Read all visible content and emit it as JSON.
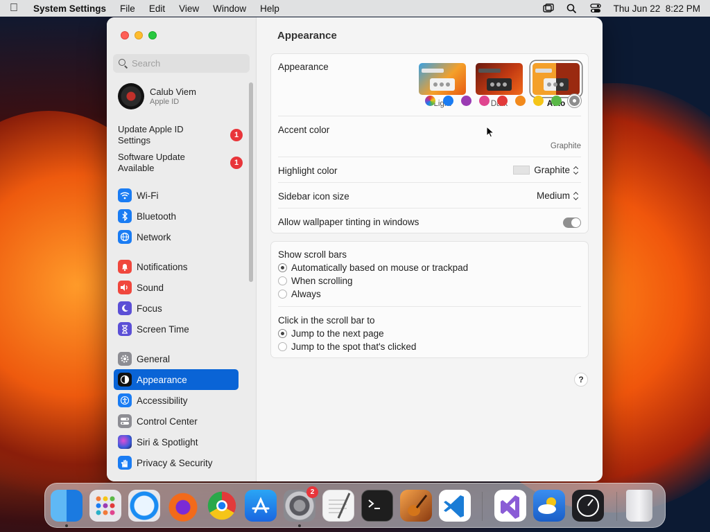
{
  "menubar": {
    "app_name": "System Settings",
    "menus": [
      "File",
      "Edit",
      "View",
      "Window",
      "Help"
    ],
    "clock": "Thu Jun 22  8:22 PM"
  },
  "sidebar": {
    "search_placeholder": "Search",
    "account": {
      "name": "Calub Viem",
      "subtitle": "Apple ID"
    },
    "notifications": [
      {
        "label": "Update Apple ID Settings",
        "badge": "1"
      },
      {
        "label": "Software Update Available",
        "badge": "1"
      }
    ],
    "items": [
      {
        "label": "Wi-Fi",
        "icon": "wifi-icon",
        "color": "#1a7cf3"
      },
      {
        "label": "Bluetooth",
        "icon": "bluetooth-icon",
        "color": "#1a7cf3"
      },
      {
        "label": "Network",
        "icon": "globe-icon",
        "color": "#1a7cf3"
      },
      {
        "label": "Notifications",
        "icon": "bell-icon",
        "color": "#f0473d"
      },
      {
        "label": "Sound",
        "icon": "speaker-icon",
        "color": "#f0473d"
      },
      {
        "label": "Focus",
        "icon": "moon-icon",
        "color": "#5b4fd6"
      },
      {
        "label": "Screen Time",
        "icon": "hourglass-icon",
        "color": "#5b4fd6"
      },
      {
        "label": "General",
        "icon": "gear-icon",
        "color": "#8d8d93"
      },
      {
        "label": "Appearance",
        "icon": "appearance-icon",
        "color": "#111111"
      },
      {
        "label": "Accessibility",
        "icon": "accessibility-icon",
        "color": "#1a7cf3"
      },
      {
        "label": "Control Center",
        "icon": "toggles-icon",
        "color": "#8d8d93"
      },
      {
        "label": "Siri & Spotlight",
        "icon": "siri-icon",
        "color": "#2b2b6b"
      },
      {
        "label": "Privacy & Security",
        "icon": "hand-icon",
        "color": "#1a7cf3"
      }
    ]
  },
  "main": {
    "title": "Appearance",
    "appearance": {
      "label": "Appearance",
      "options": [
        "Light",
        "Dark",
        "Auto"
      ],
      "selected": "Auto"
    },
    "accent": {
      "label": "Accent color",
      "colors": [
        "#8a5cf6",
        "#1a7cf3",
        "#9b3bb3",
        "#e0458f",
        "#e23a3a",
        "#f28a1c",
        "#f5c518",
        "#5ab847",
        "#8d8d8d"
      ],
      "selected_name": "Graphite"
    },
    "highlight": {
      "label": "Highlight color",
      "value": "Graphite"
    },
    "sidebar_icon_size": {
      "label": "Sidebar icon size",
      "value": "Medium"
    },
    "wallpaper_tinting": {
      "label": "Allow wallpaper tinting in windows"
    },
    "scroll_bars": {
      "label": "Show scroll bars",
      "options": [
        "Automatically based on mouse or trackpad",
        "When scrolling",
        "Always"
      ]
    },
    "click_scroll": {
      "label": "Click in the scroll bar to",
      "options": [
        "Jump to the next page",
        "Jump to the spot that's clicked"
      ]
    },
    "help": "?"
  },
  "dock": {
    "settings_badge": "2"
  }
}
